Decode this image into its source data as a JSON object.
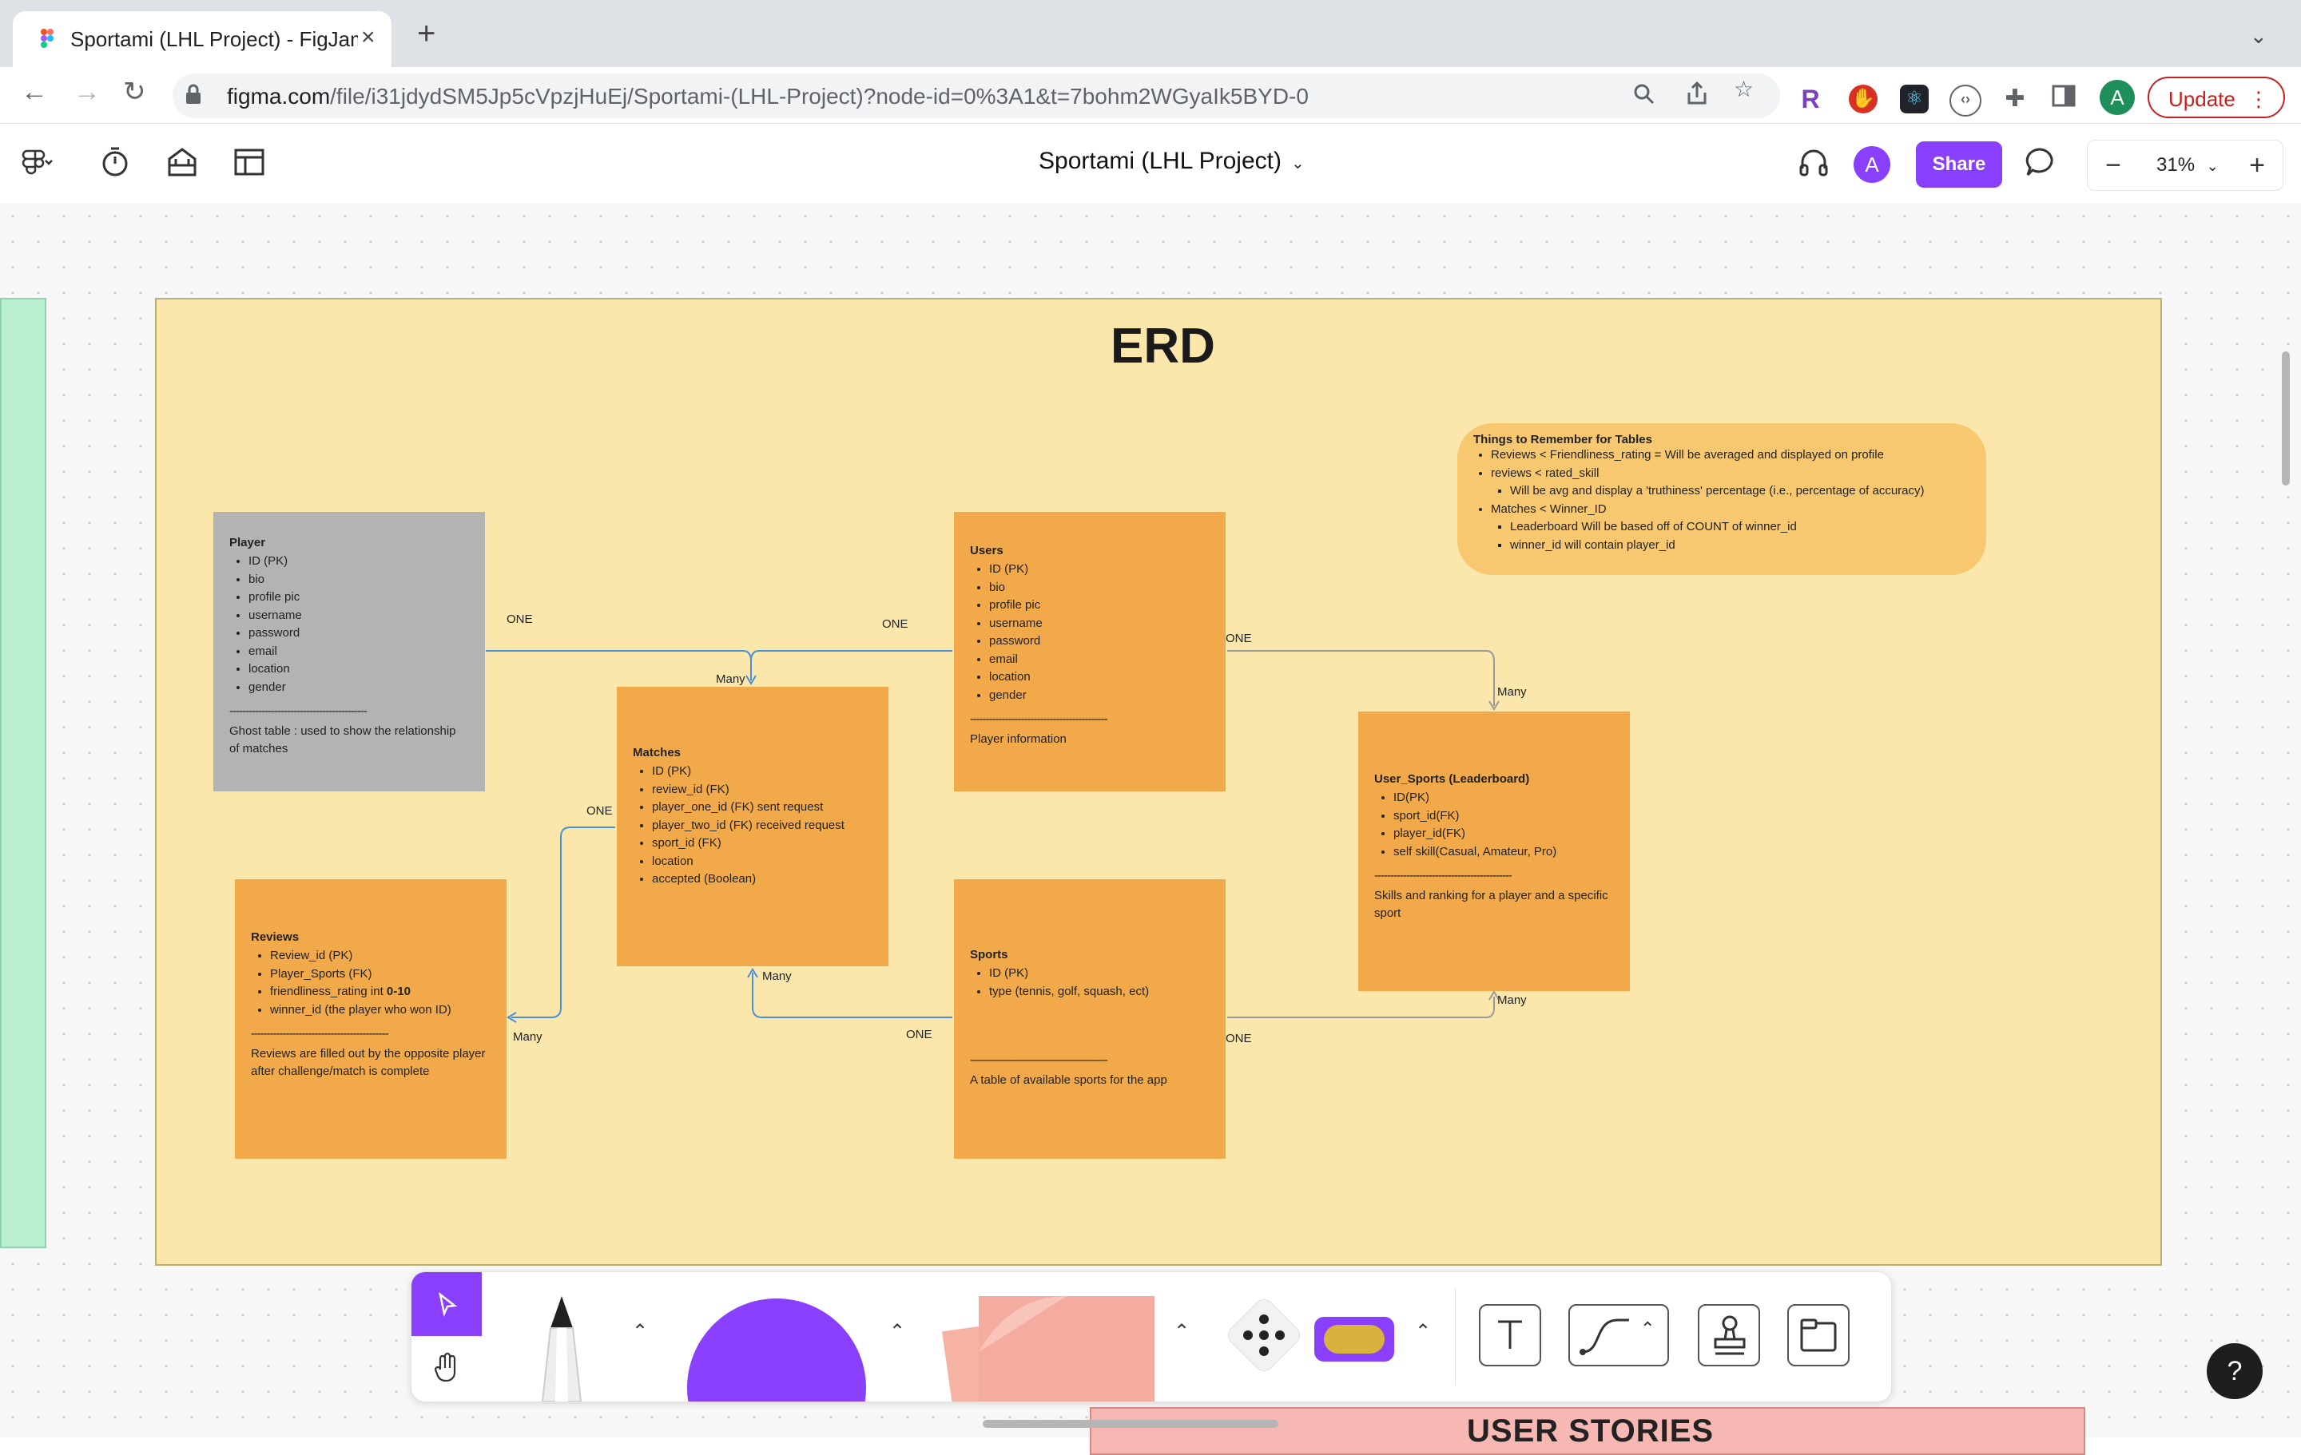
{
  "browser": {
    "tab_title": "Sportami (LHL Project) - FigJam",
    "url_main": "figma.com",
    "url_rest": "/file/i31jdydSM5Jp5cVpzjHuEj/Sportami-(LHL-Project)?node-id=0%3A1&t=7bohm2WGyaIk5BYD-0",
    "update_label": "Update",
    "profile_initial": "A"
  },
  "figjam": {
    "file_name": "Sportami (LHL Project)",
    "share_label": "Share",
    "avatar_initial": "A",
    "zoom": "31%"
  },
  "erd": {
    "title": "ERD",
    "notes": {
      "title": "Things to Remember for Tables",
      "items": [
        "Reviews < Friendliness_rating = Will be averaged and displayed on profile",
        "reviews < rated_skill",
        "Will be avg and display a 'truthiness' percentage (i.e., percentage of accuracy)",
        "Matches < Winner_ID",
        "Leaderboard Will be based off of COUNT of winner_id",
        "winner_id will contain player_id"
      ]
    },
    "tables": {
      "player": {
        "title": "Player",
        "fields": [
          "ID (PK)",
          "bio",
          "profile pic",
          "username",
          "password",
          "email",
          "location",
          "gender"
        ],
        "separator": "-------------------------------------------",
        "description": "Ghost table : used to show the relationship of matches"
      },
      "users": {
        "title": "Users",
        "fields": [
          "ID (PK)",
          "bio",
          "profile pic",
          "username",
          "password",
          "email",
          "location",
          "gender"
        ],
        "separator": "-------------------------------------------",
        "description": "Player information"
      },
      "matches": {
        "title": "Matches",
        "fields": [
          "ID (PK)",
          "review_id (FK)",
          "player_one_id (FK) sent request",
          "player_two_id (FK) received request",
          "sport_id (FK)",
          "location",
          "accepted (Boolean)"
        ]
      },
      "user_sports": {
        "title": "User_Sports (Leaderboard)",
        "fields": [
          "ID(PK)",
          "sport_id(FK)",
          "player_id(FK)",
          "self skill(Casual, Amateur, Pro)"
        ],
        "separator": "-------------------------------------------",
        "description": "Skills and ranking for a player and a specific sport"
      },
      "reviews": {
        "title": "Reviews",
        "fields": [
          "Review_id (PK)",
          "Player_Sports (FK)",
          "friendliness_rating int ",
          "winner_id (the player who won ID)"
        ],
        "friendliness_range": "0-10",
        "separator": "-------------------------------------------",
        "description": "Reviews are filled out by the opposite player after challenge/match is complete"
      },
      "sports": {
        "title": "Sports",
        "fields": [
          "ID (PK)",
          "type (tennis, golf, squash, ect)"
        ],
        "separator": "-------------------------------------------",
        "description": "A table of available sports for the app"
      }
    },
    "relations": {
      "one": "ONE",
      "many": "Many"
    }
  },
  "canvas": {
    "user_stories_label": "USER STORIES",
    "help_label": "?"
  }
}
